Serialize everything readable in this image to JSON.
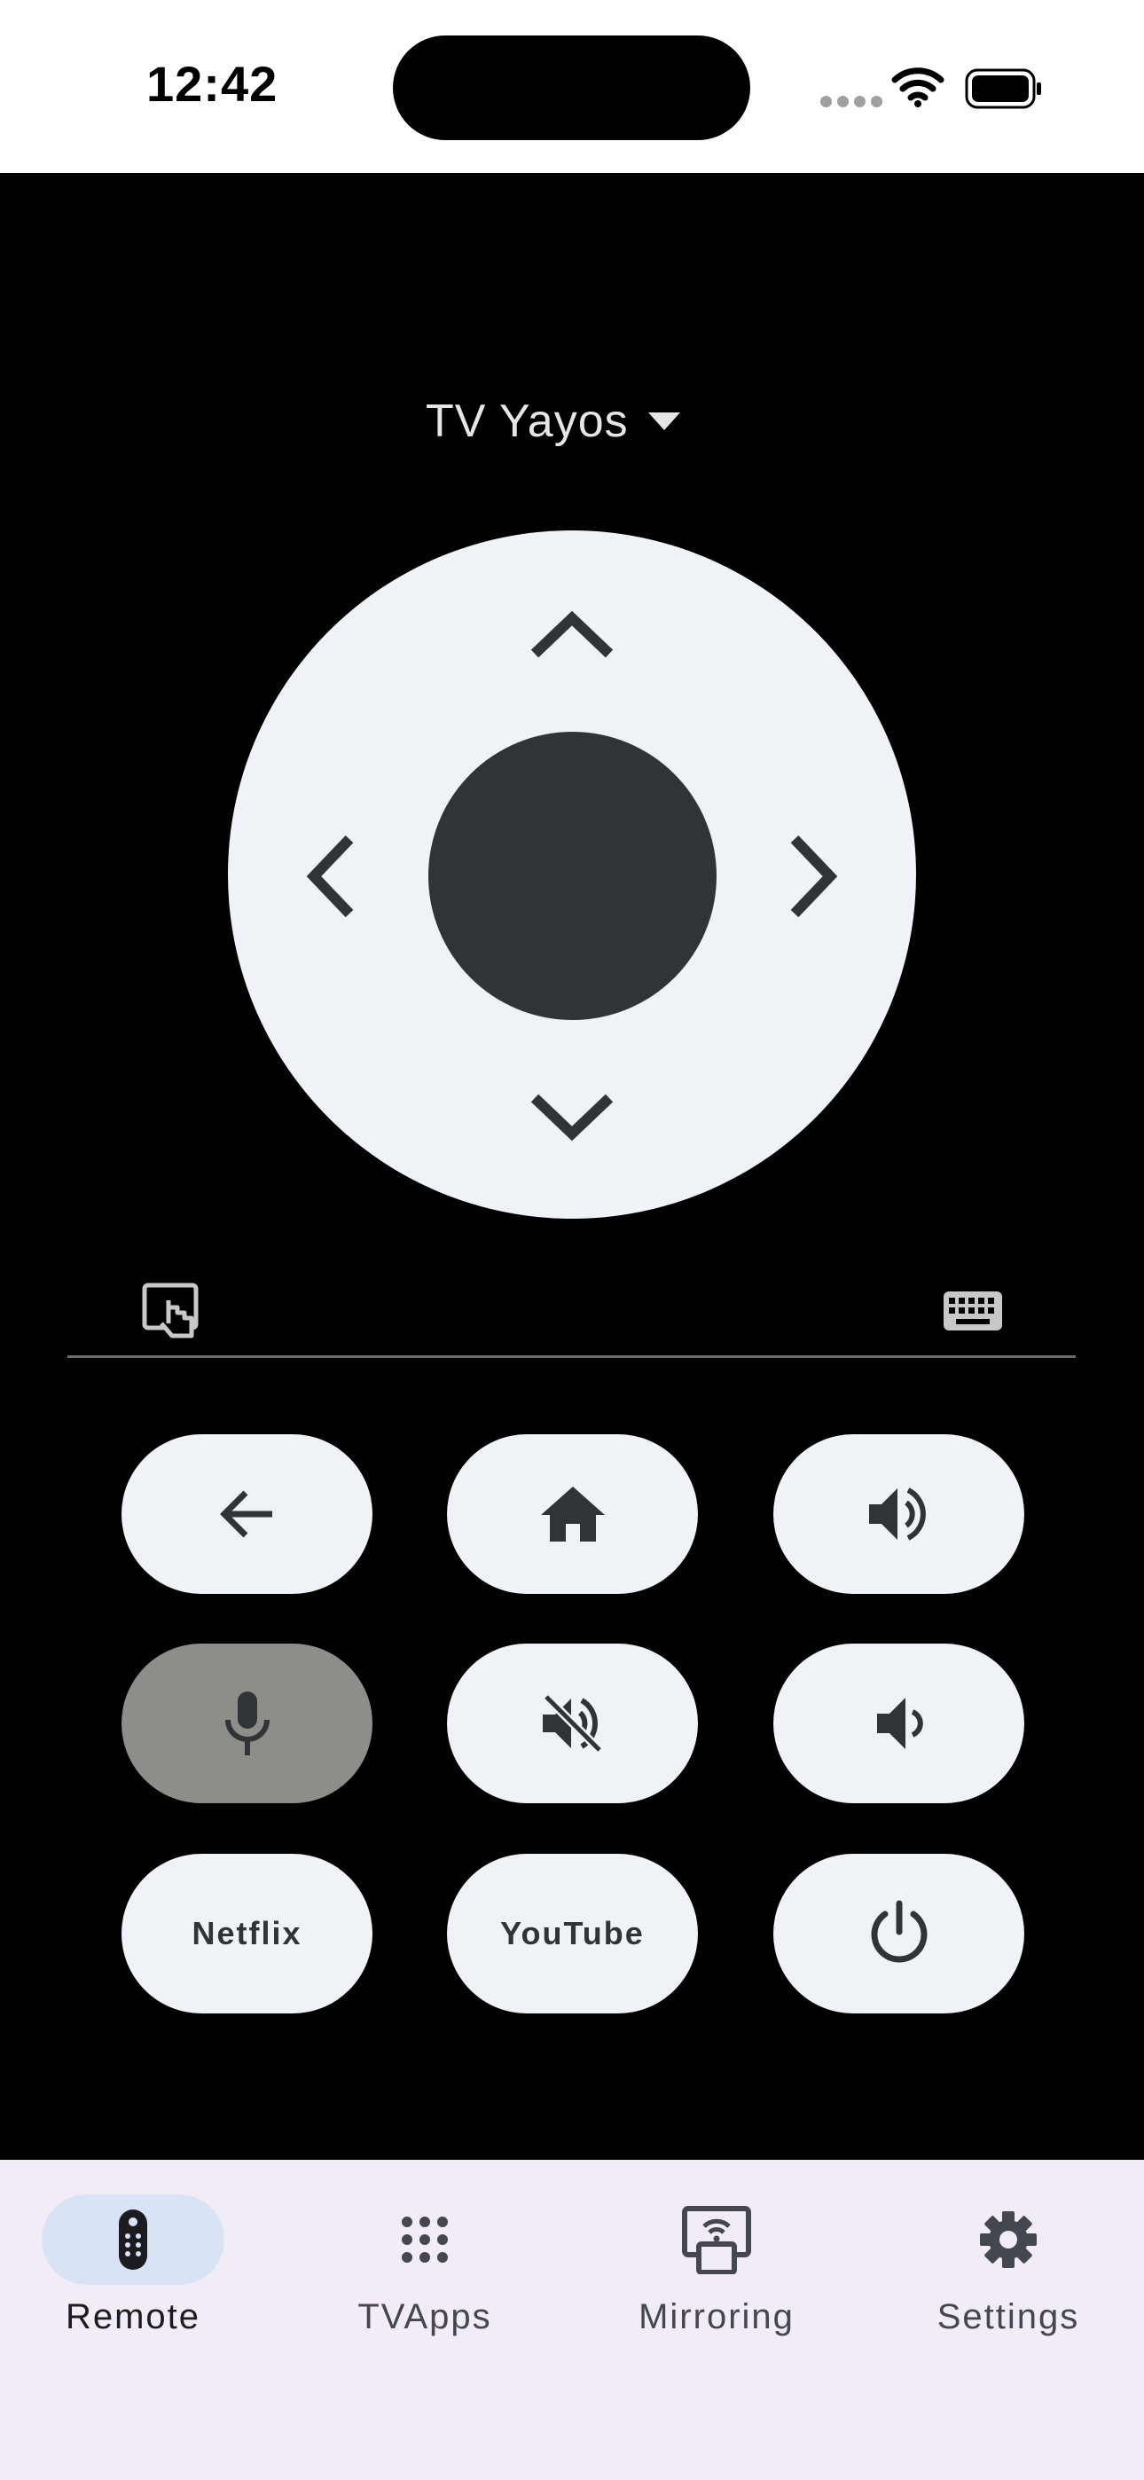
{
  "status_bar": {
    "time": "12:42"
  },
  "device": {
    "name": "TV Yayos"
  },
  "buttons": {
    "netflix": "Netflix",
    "youtube": "YouTube"
  },
  "nav": {
    "items": [
      {
        "label": "Remote",
        "icon": "remote-icon",
        "selected": true
      },
      {
        "label": "TVApps",
        "icon": "apps-grid-icon",
        "selected": false
      },
      {
        "label": "Mirroring",
        "icon": "cast-icon",
        "selected": false
      },
      {
        "label": "Settings",
        "icon": "gear-icon",
        "selected": false
      }
    ]
  },
  "colors": {
    "background": "#000000",
    "pad": "#eff2f6",
    "pad_center": "#303437",
    "mic_active": "#8d8e89",
    "nav_background": "#f2ecf6",
    "nav_selected_pill": "#d9e3f6"
  }
}
